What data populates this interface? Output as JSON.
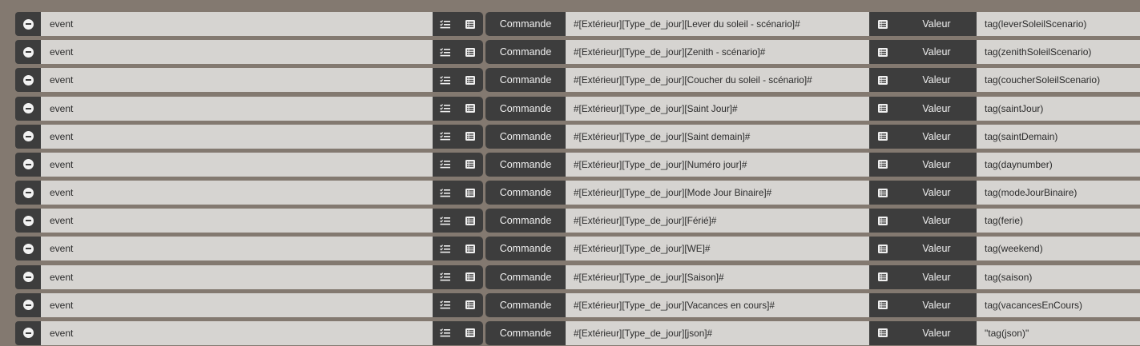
{
  "rows": [
    {
      "type": "event",
      "command_label": "Commande",
      "command": "#[Extérieur][Type_de_jour][Lever du soleil - scénario]#",
      "value_label": "Valeur",
      "value": "tag(leverSoleilScenario)"
    },
    {
      "type": "event",
      "command_label": "Commande",
      "command": "#[Extérieur][Type_de_jour][Zenith - scénario]#",
      "value_label": "Valeur",
      "value": "tag(zenithSoleilScenario)"
    },
    {
      "type": "event",
      "command_label": "Commande",
      "command": "#[Extérieur][Type_de_jour][Coucher du soleil - scénario]#",
      "value_label": "Valeur",
      "value": "tag(coucherSoleilScenario)"
    },
    {
      "type": "event",
      "command_label": "Commande",
      "command": "#[Extérieur][Type_de_jour][Saint Jour]#",
      "value_label": "Valeur",
      "value": "tag(saintJour)"
    },
    {
      "type": "event",
      "command_label": "Commande",
      "command": "#[Extérieur][Type_de_jour][Saint demain]#",
      "value_label": "Valeur",
      "value": "tag(saintDemain)"
    },
    {
      "type": "event",
      "command_label": "Commande",
      "command": "#[Extérieur][Type_de_jour][Numéro jour]#",
      "value_label": "Valeur",
      "value": "tag(daynumber)"
    },
    {
      "type": "event",
      "command_label": "Commande",
      "command": "#[Extérieur][Type_de_jour][Mode Jour Binaire]#",
      "value_label": "Valeur",
      "value": "tag(modeJourBinaire)"
    },
    {
      "type": "event",
      "command_label": "Commande",
      "command": "#[Extérieur][Type_de_jour][Férié]#",
      "value_label": "Valeur",
      "value": "tag(ferie)"
    },
    {
      "type": "event",
      "command_label": "Commande",
      "command": "#[Extérieur][Type_de_jour][WE]#",
      "value_label": "Valeur",
      "value": "tag(weekend)"
    },
    {
      "type": "event",
      "command_label": "Commande",
      "command": "#[Extérieur][Type_de_jour][Saison]#",
      "value_label": "Valeur",
      "value": "tag(saison)"
    },
    {
      "type": "event",
      "command_label": "Commande",
      "command": "#[Extérieur][Type_de_jour][Vacances en cours]#",
      "value_label": "Valeur",
      "value": "tag(vacancesEnCours)"
    },
    {
      "type": "event",
      "command_label": "Commande",
      "command": "#[Extérieur][Type_de_jour][json]#",
      "value_label": "Valeur",
      "value": "\"tag(json)\""
    }
  ],
  "icons": {
    "remove": "minus-circle-icon",
    "select_event": "checklist-icon",
    "select_command": "list-icon",
    "select_value": "list-icon"
  },
  "colors": {
    "background": "#837970",
    "dark": "#3d3d3d",
    "light": "#d6d4d1"
  }
}
